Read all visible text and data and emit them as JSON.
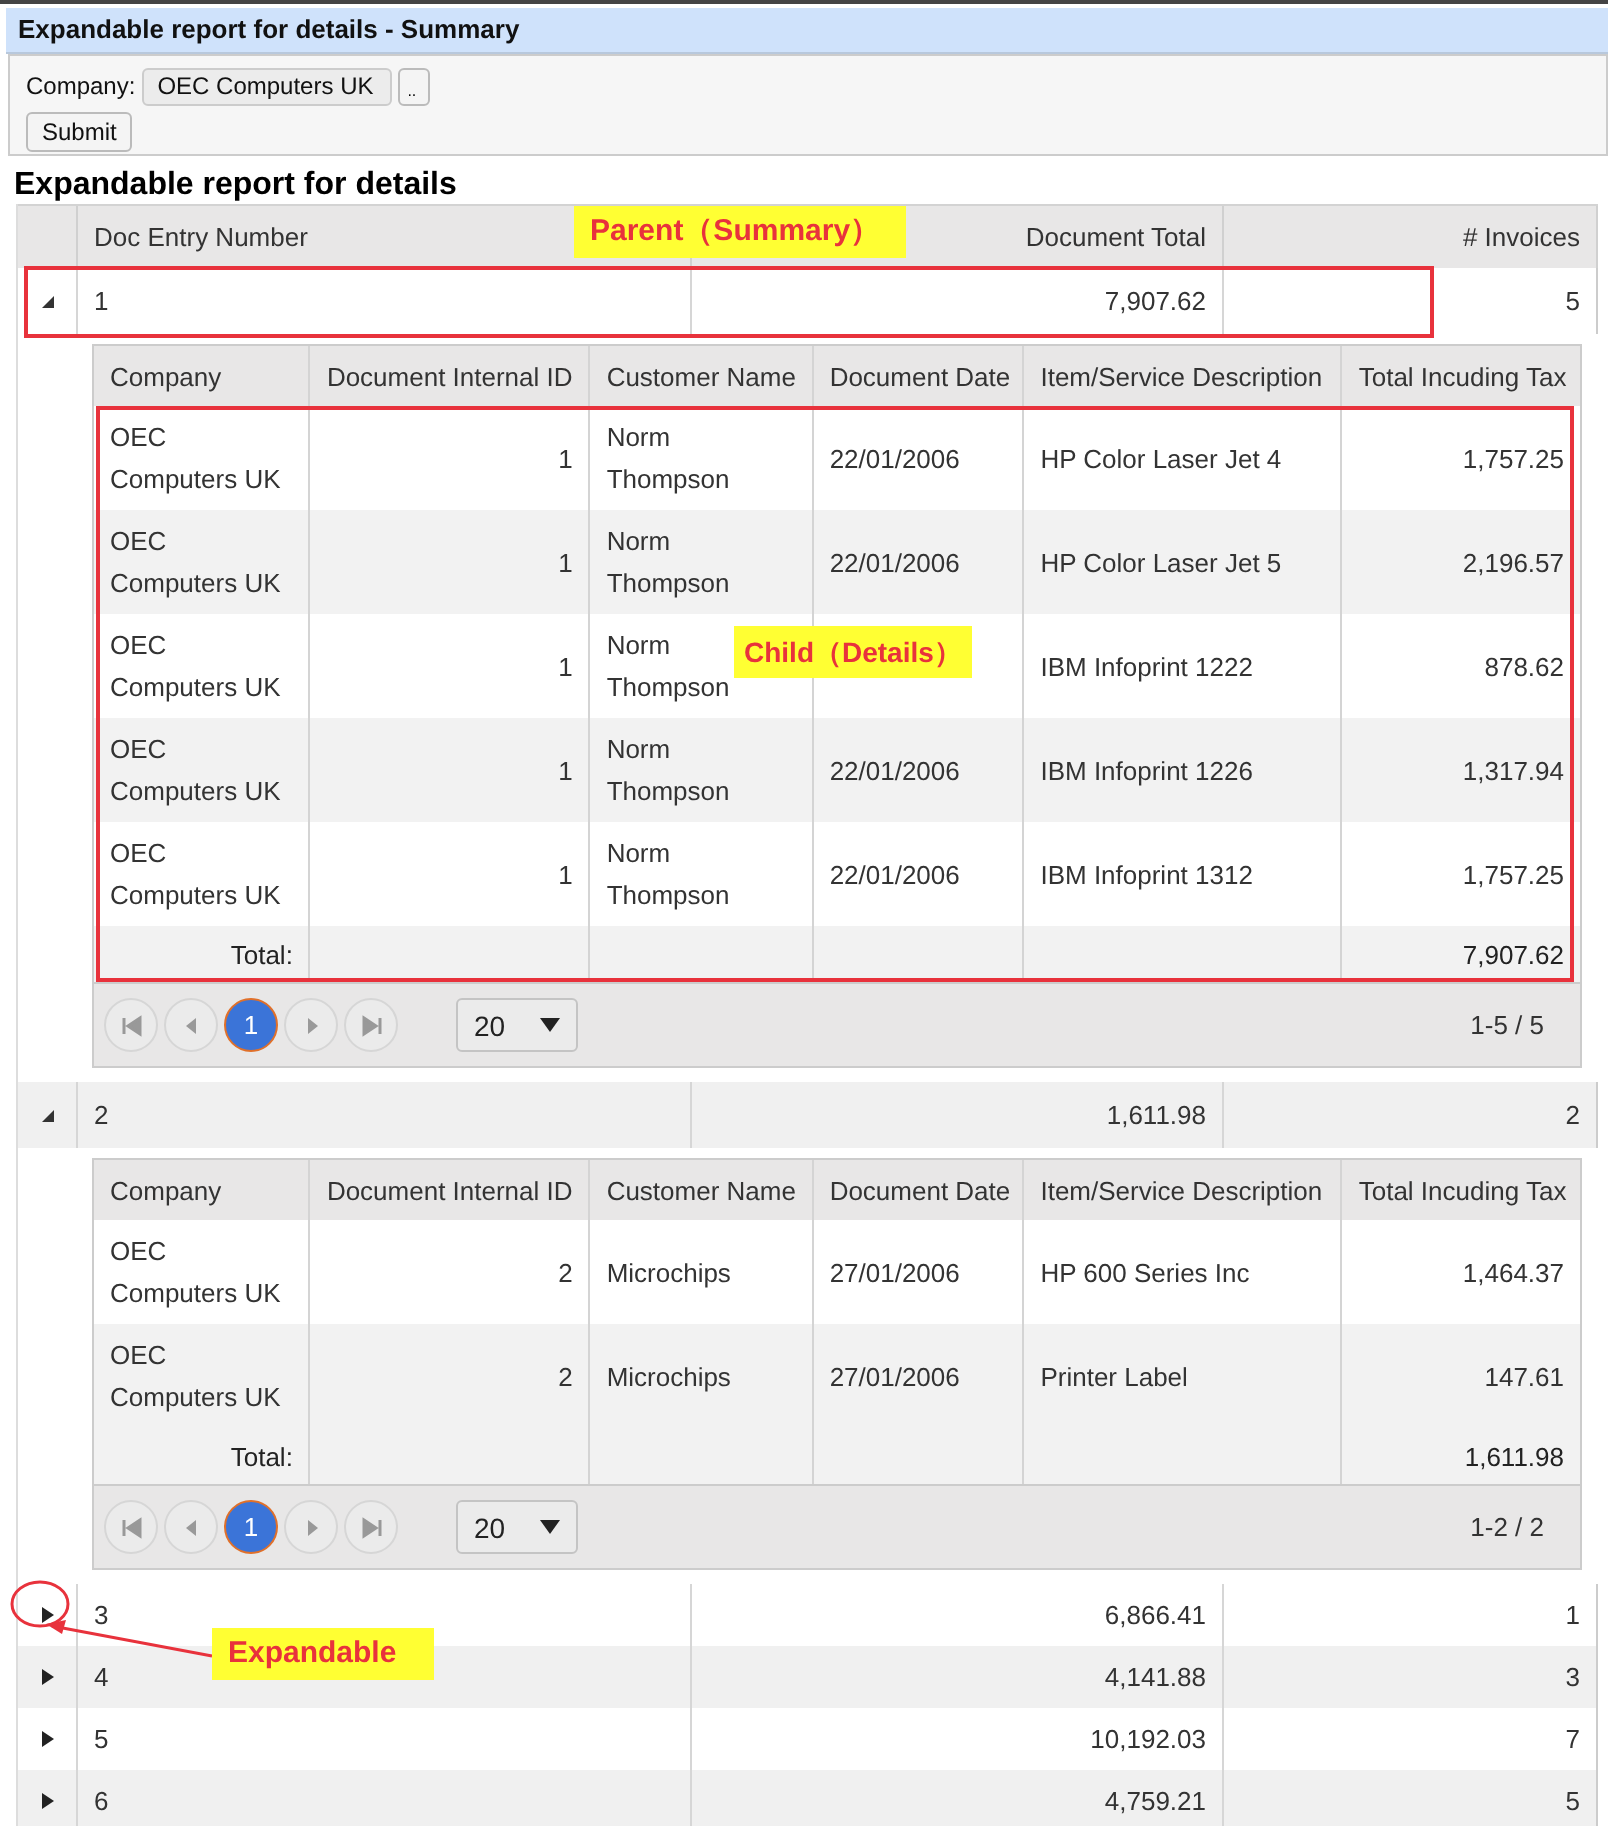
{
  "window": {
    "title": "Expandable report for details - Summary"
  },
  "filter": {
    "label": "Company:",
    "value": "OEC Computers UK",
    "lookup_button": "..",
    "submit_button": "Submit"
  },
  "report": {
    "title": "Expandable report for details",
    "columns": [
      "Doc Entry Number",
      "Document Total",
      "# Invoices"
    ],
    "rows": [
      {
        "doc_entry": "1",
        "document_total": "7,907.62",
        "invoices": "5",
        "expanded": true,
        "details": {
          "columns": [
            "Company",
            "Document Internal ID",
            "Customer Name",
            "Document Date",
            "Item/Service Description",
            "Total Incuding Tax"
          ],
          "rows": [
            [
              "OEC Computers UK",
              "1",
              "Norm Thompson",
              "22/01/2006",
              "HP Color Laser Jet 4",
              "1,757.25"
            ],
            [
              "OEC Computers UK",
              "1",
              "Norm Thompson",
              "22/01/2006",
              "HP Color Laser Jet 5",
              "2,196.57"
            ],
            [
              "OEC Computers UK",
              "1",
              "Norm Thompson",
              "",
              "IBM Infoprint 1222",
              "878.62"
            ],
            [
              "OEC Computers UK",
              "1",
              "Norm Thompson",
              "22/01/2006",
              "IBM Infoprint 1226",
              "1,317.94"
            ],
            [
              "OEC Computers UK",
              "1",
              "Norm Thompson",
              "22/01/2006",
              "IBM Infoprint 1312",
              "1,757.25"
            ]
          ],
          "total_label": "Total:",
          "total": "7,907.62",
          "pager": {
            "pages": [
              {
                "label": "1",
                "selected": true
              }
            ],
            "page_size": "20",
            "range": "1-5 / 5"
          }
        }
      },
      {
        "doc_entry": "2",
        "document_total": "1,611.98",
        "invoices": "2",
        "expanded": true,
        "details": {
          "columns": [
            "Company",
            "Document Internal ID",
            "Customer Name",
            "Document Date",
            "Item/Service Description",
            "Total Incuding Tax"
          ],
          "rows": [
            [
              "OEC Computers UK",
              "2",
              "Microchips",
              "27/01/2006",
              "HP 600 Series Inc",
              "1,464.37"
            ],
            [
              "OEC Computers UK",
              "2",
              "Microchips",
              "27/01/2006",
              "Printer Label",
              "147.61"
            ]
          ],
          "total_label": "Total:",
          "total": "1,611.98",
          "pager": {
            "pages": [
              {
                "label": "1",
                "selected": true
              }
            ],
            "page_size": "20",
            "range": "1-2 / 2"
          }
        }
      },
      {
        "doc_entry": "3",
        "document_total": "6,866.41",
        "invoices": "1",
        "expanded": false
      },
      {
        "doc_entry": "4",
        "document_total": "4,141.88",
        "invoices": "3",
        "expanded": false
      },
      {
        "doc_entry": "5",
        "document_total": "10,192.03",
        "invoices": "7",
        "expanded": false
      },
      {
        "doc_entry": "6",
        "document_total": "4,759.21",
        "invoices": "5",
        "expanded": false
      }
    ]
  },
  "annotations": [
    {
      "kind": "frame"
    },
    {
      "kind": "frame"
    },
    {
      "kind": "label",
      "text": "Parent（Summary）"
    },
    {
      "kind": "label",
      "text": "Child（Details）"
    },
    {
      "kind": "pointer"
    },
    {
      "kind": "label",
      "text": "Expandable"
    }
  ]
}
